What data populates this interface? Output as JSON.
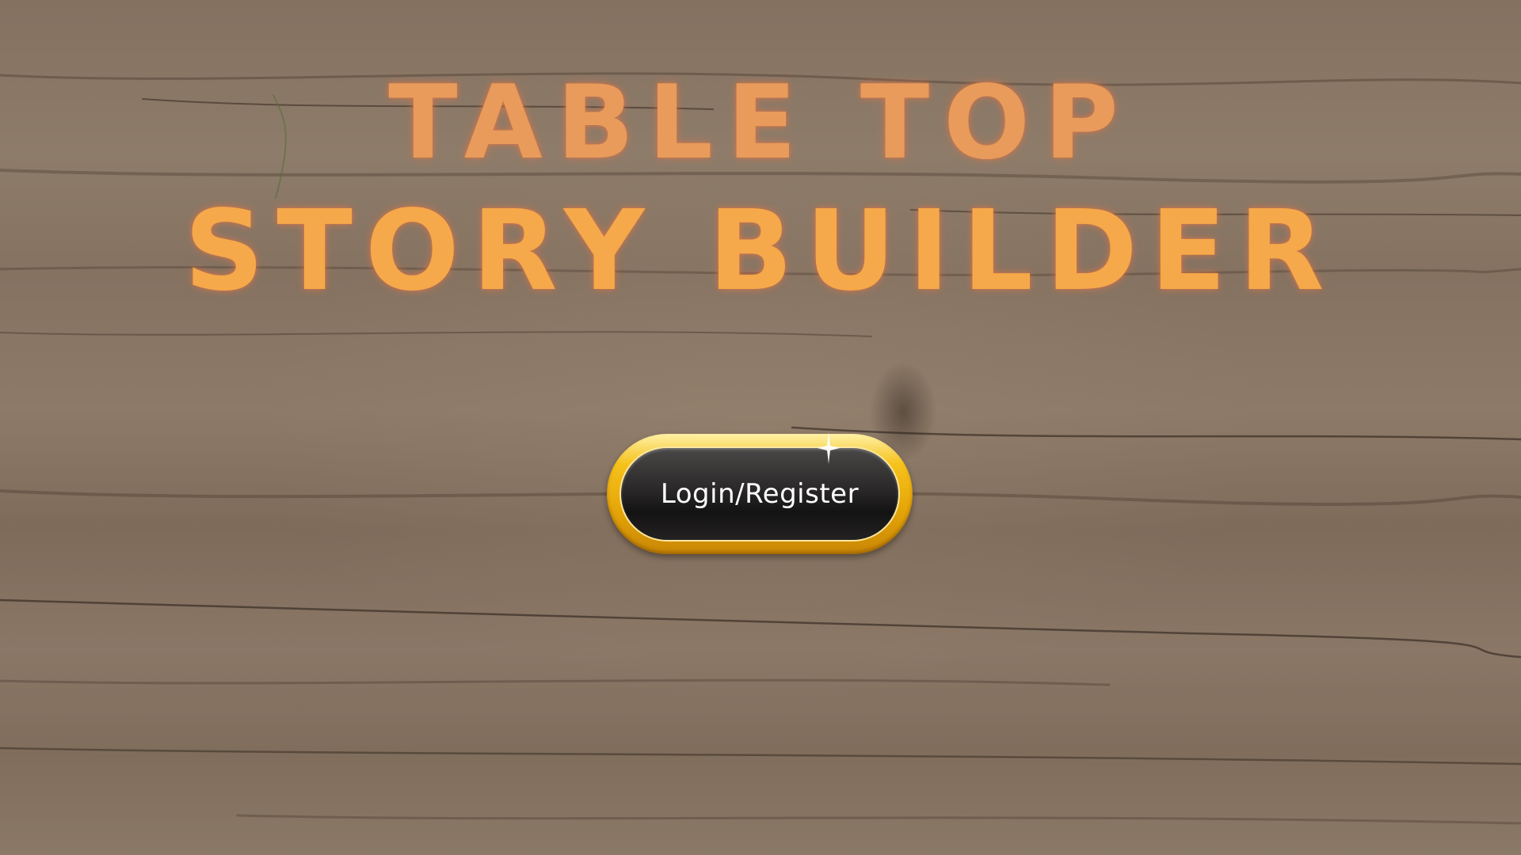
{
  "page": {
    "title_line_1": "TABLE TOP",
    "title_line_2": "STORY BUILDER"
  },
  "login_button": {
    "label": "Login/Register"
  },
  "colors": {
    "title_top": "#e89b5b",
    "title_bottom": "#f6a94a",
    "button_gold": "#f6c21c",
    "button_inner": "#2a2828",
    "wood": "#8a7663"
  },
  "icons": {
    "sparkle": "sparkle-icon"
  }
}
